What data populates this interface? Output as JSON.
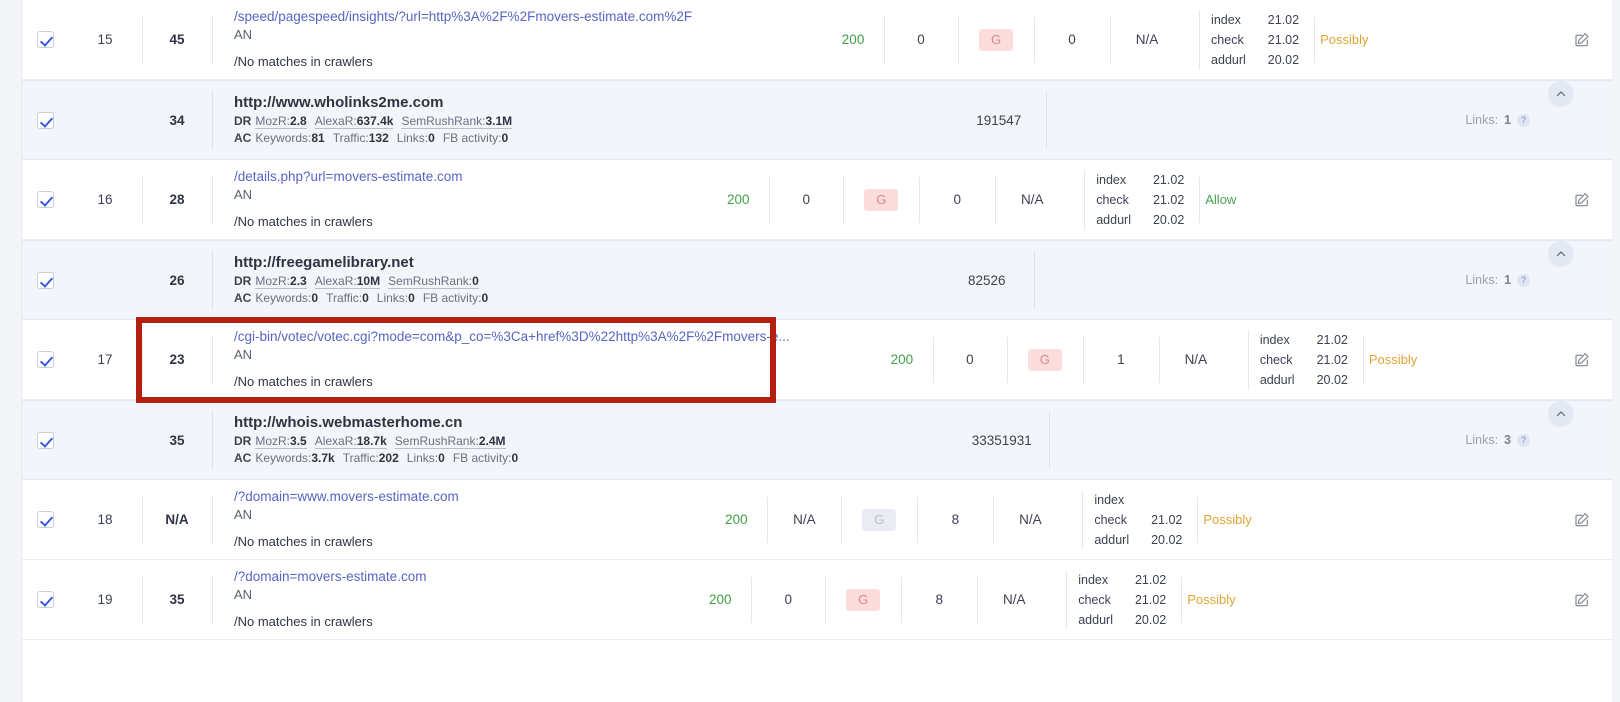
{
  "colors": {
    "accent_link": "#5566c4",
    "status_ok": "#43a047",
    "rule_possibly": "#e0a535",
    "rule_allow": "#46a24f",
    "badge_active_bg": "#fbdddd",
    "badge_inactive_bg": "#e9edf3",
    "highlight_border": "#b51f10",
    "group_row_bg": "#f2f5f9"
  },
  "highlight": {
    "name": "red-highlight-box",
    "target_row_index": 17
  },
  "icons": {
    "edit": "edit-icon",
    "collapse": "chevron-up-icon",
    "help": "question-mark-icon",
    "checkbox": "checkbox-checked-icon"
  },
  "labels": {
    "an": "AN",
    "no_matches": "/No matches in crawlers",
    "dr": "DR",
    "ac": "AC",
    "links_prefix": "Links:",
    "date_keys": [
      "index",
      "check",
      "addurl"
    ],
    "help_glyph": "?"
  },
  "rows": [
    {
      "kind": "url",
      "checked": true,
      "num": "15",
      "rank": "45",
      "url": "/speed/pagespeed/insights/?url=http%3A%2F%2Fmovers-estimate.com%2F",
      "an": "AN",
      "no_matches": "/No matches in crawlers",
      "status_code": "200",
      "v1": "0",
      "g": "G",
      "g_active": true,
      "v2": "0",
      "v3": "N/A",
      "dates": [
        {
          "key": "index",
          "value": "21.02"
        },
        {
          "key": "check",
          "value": "21.02"
        },
        {
          "key": "addurl",
          "value": "20.02"
        }
      ],
      "rule": "Possibly",
      "rule_kind": "possibly",
      "highlighted": false
    },
    {
      "kind": "domain",
      "checked": true,
      "num": "",
      "rank": "34",
      "host": "http://www.wholinks2me.com",
      "dr": [
        {
          "label": "MozR:",
          "value": "2.8"
        },
        {
          "label": "AlexaR:",
          "value": "637.4k"
        },
        {
          "label": "SemRushRank:",
          "value": "3.1M"
        }
      ],
      "ac": [
        {
          "label": "Keywords:",
          "value": "81"
        },
        {
          "label": "Traffic:",
          "value": "132"
        },
        {
          "label": "Links:",
          "value": "0"
        },
        {
          "label": "FB activity:",
          "value": "0"
        }
      ],
      "count": "191547",
      "links_label": "Links:",
      "links_value": "1"
    },
    {
      "kind": "url",
      "checked": true,
      "num": "16",
      "rank": "28",
      "url": "/details.php?url=movers-estimate.com",
      "an": "AN",
      "no_matches": "/No matches in crawlers",
      "status_code": "200",
      "v1": "0",
      "g": "G",
      "g_active": true,
      "v2": "0",
      "v3": "N/A",
      "dates": [
        {
          "key": "index",
          "value": "21.02"
        },
        {
          "key": "check",
          "value": "21.02"
        },
        {
          "key": "addurl",
          "value": "20.02"
        }
      ],
      "rule": "Allow",
      "rule_kind": "allow",
      "highlighted": false
    },
    {
      "kind": "domain",
      "checked": true,
      "num": "",
      "rank": "26",
      "host": "http://freegamelibrary.net",
      "dr": [
        {
          "label": "MozR:",
          "value": "2.3"
        },
        {
          "label": "AlexaR:",
          "value": "10M"
        },
        {
          "label": "SemRushRank:",
          "value": "0"
        }
      ],
      "ac": [
        {
          "label": "Keywords:",
          "value": "0"
        },
        {
          "label": "Traffic:",
          "value": "0"
        },
        {
          "label": "Links:",
          "value": "0"
        },
        {
          "label": "FB activity:",
          "value": "0"
        }
      ],
      "count": "82526",
      "links_label": "Links:",
      "links_value": "1"
    },
    {
      "kind": "url",
      "checked": true,
      "num": "17",
      "rank": "23",
      "url": "/cgi-bin/votec/votec.cgi?mode=com&p_co=%3Ca+href%3D%22http%3A%2F%2Fmovers-e...",
      "an": "AN",
      "no_matches": "/No matches in crawlers",
      "status_code": "200",
      "v1": "0",
      "g": "G",
      "g_active": true,
      "v2": "1",
      "v3": "N/A",
      "dates": [
        {
          "key": "index",
          "value": "21.02"
        },
        {
          "key": "check",
          "value": "21.02"
        },
        {
          "key": "addurl",
          "value": "20.02"
        }
      ],
      "rule": "Possibly",
      "rule_kind": "possibly",
      "highlighted": true
    },
    {
      "kind": "domain",
      "checked": true,
      "num": "",
      "rank": "35",
      "host": "http://whois.webmasterhome.cn",
      "dr": [
        {
          "label": "MozR:",
          "value": "3.5"
        },
        {
          "label": "AlexaR:",
          "value": "18.7k"
        },
        {
          "label": "SemRushRank:",
          "value": "2.4M"
        }
      ],
      "ac": [
        {
          "label": "Keywords:",
          "value": "3.7k"
        },
        {
          "label": "Traffic:",
          "value": "202"
        },
        {
          "label": "Links:",
          "value": "0"
        },
        {
          "label": "FB activity:",
          "value": "0"
        }
      ],
      "count": "33351931",
      "links_label": "Links:",
      "links_value": "3"
    },
    {
      "kind": "url",
      "checked": true,
      "num": "18",
      "rank": "N/A",
      "url": "/?domain=www.movers-estimate.com",
      "an": "AN",
      "no_matches": "/No matches in crawlers",
      "status_code": "200",
      "v1": "N/A",
      "g": "G",
      "g_active": false,
      "v2": "8",
      "v3": "N/A",
      "dates": [
        {
          "key": "index",
          "value": ""
        },
        {
          "key": "check",
          "value": "21.02"
        },
        {
          "key": "addurl",
          "value": "20.02"
        }
      ],
      "rule": "Possibly",
      "rule_kind": "possibly",
      "highlighted": false
    },
    {
      "kind": "url",
      "checked": true,
      "num": "19",
      "rank": "35",
      "url": "/?domain=movers-estimate.com",
      "an": "AN",
      "no_matches": "/No matches in crawlers",
      "status_code": "200",
      "v1": "0",
      "g": "G",
      "g_active": true,
      "v2": "8",
      "v3": "N/A",
      "dates": [
        {
          "key": "index",
          "value": "21.02"
        },
        {
          "key": "check",
          "value": "21.02"
        },
        {
          "key": "addurl",
          "value": "20.02"
        }
      ],
      "rule": "Possibly",
      "rule_kind": "possibly",
      "highlighted": false
    }
  ]
}
